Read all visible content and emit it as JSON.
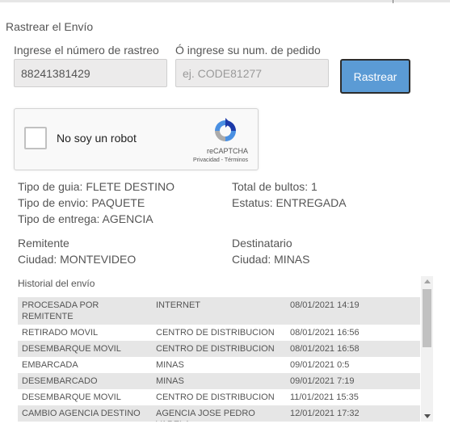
{
  "section": {
    "title": "Rastrear el Envío"
  },
  "tracking": {
    "label": "Ingrese el número de rastreo",
    "value": "88241381429"
  },
  "order": {
    "label": "Ó ingrese su num. de pedido",
    "placeholder": "ej. CODE81277"
  },
  "track_button": "Rastrear",
  "captcha": {
    "label": "No soy un robot",
    "brand": "reCAPTCHA",
    "links": "Privacidad - Términos"
  },
  "shipment": {
    "guide_type": "Tipo de guia: FLETE DESTINO",
    "ship_type": "Tipo de envio: PAQUETE",
    "delivery_type": "Tipo de entrega: AGENCIA",
    "packages": "Total de bultos: 1",
    "status": "Estatus: ENTREGADA",
    "sender_heading": "Remitente",
    "sender_city": "Ciudad: MONTEVIDEO",
    "recipient_heading": "Destinatario",
    "recipient_city": "Ciudad: MINAS"
  },
  "history": {
    "title": "Historial del envío",
    "rows": [
      [
        "PROCESADA POR REMITENTE",
        "INTERNET",
        "08/01/2021 14:19"
      ],
      [
        "RETIRADO MOVIL",
        "CENTRO DE DISTRIBUCION",
        "08/01/2021 16:56"
      ],
      [
        "DESEMBARQUE MOVIL",
        "CENTRO DE DISTRIBUCION",
        "08/01/2021 16:58"
      ],
      [
        "EMBARCADA",
        "MINAS",
        "09/01/2021 0:5"
      ],
      [
        "DESEMBARCADO",
        "MINAS",
        "09/01/2021 7:19"
      ],
      [
        "DESEMBARQUE MOVIL",
        "CENTRO DE DISTRIBUCION",
        "11/01/2021 15:35"
      ],
      [
        "CAMBIO AGENCIA DESTINO",
        "AGENCIA JOSE PEDRO VARELA",
        "12/01/2021 17:32"
      ]
    ]
  },
  "colors": {
    "button": "#5b9bd5",
    "row_shade": "#e6e6e6",
    "captcha_blue": "#4a90e2"
  }
}
